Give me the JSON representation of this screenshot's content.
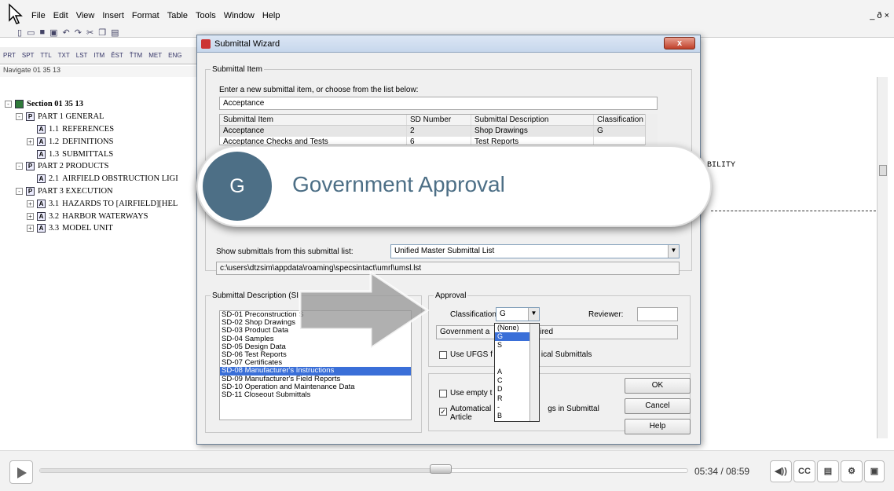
{
  "app": {
    "menu": [
      "File",
      "Edit",
      "View",
      "Insert",
      "Format",
      "Table",
      "Tools",
      "Window",
      "Help"
    ],
    "window_controls": "_ ð ×",
    "toolbar2": [
      "PRT",
      "SPT",
      "TTL",
      "TXT",
      "LST",
      "ITM",
      "ĚST",
      "ŤTM",
      "MET",
      "ENG"
    ],
    "navigate_label": "Navigate 01 35 13"
  },
  "tree": [
    {
      "level": 0,
      "box": "-",
      "icon": "",
      "num": "",
      "label": "Section 01 35 13"
    },
    {
      "level": 1,
      "box": "-",
      "icon": "P",
      "num": "",
      "label": "PART 1  GENERAL"
    },
    {
      "level": 2,
      "box": "",
      "icon": "A",
      "num": "1.1",
      "label": "REFERENCES"
    },
    {
      "level": 2,
      "box": "+",
      "icon": "A",
      "num": "1.2",
      "label": "DEFINITIONS"
    },
    {
      "level": 2,
      "box": "",
      "icon": "A",
      "num": "1.3",
      "label": "SUBMITTALS"
    },
    {
      "level": 1,
      "box": "-",
      "icon": "P",
      "num": "",
      "label": "PART 2  PRODUCTS"
    },
    {
      "level": 2,
      "box": "",
      "icon": "A",
      "num": "2.1",
      "label": "AIRFIELD OBSTRUCTION LIGI"
    },
    {
      "level": 1,
      "box": "-",
      "icon": "P",
      "num": "",
      "label": "PART 3  EXECUTION"
    },
    {
      "level": 2,
      "box": "+",
      "icon": "A",
      "num": "3.1",
      "label": "HAZARDS TO [AIRFIELD][HEL"
    },
    {
      "level": 2,
      "box": "+",
      "icon": "A",
      "num": "3.2",
      "label": "HARBOR WATERWAYS"
    },
    {
      "level": 2,
      "box": "+",
      "icon": "A",
      "num": "3.3",
      "label": "MODEL UNIT"
    }
  ],
  "doc": {
    "ability_text": "BILITY"
  },
  "wizard": {
    "title": "Submittal Wizard",
    "close": "x",
    "item_legend": "Submittal Item",
    "instruction": "Enter a new submittal item, or choose from the list below:",
    "item_value": "Acceptance",
    "columns": [
      "Submittal Item",
      "SD Number",
      "Submittal Description",
      "Classification"
    ],
    "rows": [
      [
        "Acceptance",
        "2",
        "Shop Drawings",
        "G"
      ],
      [
        "Acceptance Checks and Tests",
        "6",
        "Test Reports",
        ""
      ]
    ],
    "show_label": "Show submittals from this submittal list:",
    "list_value": "Unified Master Submittal List",
    "path": "c:\\users\\dtzsim\\appdata\\roaming\\specsintact\\umrl\\umsl.lst",
    "sd_legend": "Submittal Description (SI",
    "sd_items": [
      "SD-01 Preconstruction S",
      "SD-02 Shop Drawings",
      "SD-03 Product Data",
      "SD-04 Samples",
      "SD-05 Design Data",
      "SD-06 Test Reports",
      "SD-07 Certificates",
      "SD-08 Manufacturer's Instructions",
      "SD-09 Manufacturer's Field Reports",
      "SD-10 Operation and Maintenance Data",
      "SD-11 Closeout Submittals"
    ],
    "approval_legend": "Approval",
    "classification_label": "Classification",
    "classification_value": "G",
    "reviewer_label": "Reviewer:",
    "gov_text": "Government a",
    "gov_text2": "ired",
    "ufgs_label": "Use UFGS f",
    "ufgs_label2": "ical Submittals",
    "empty_label": "Use empty t",
    "auto_label": "Automatical",
    "auto_label2": "gs in Submittal",
    "article_label": "Article",
    "dropdown_options": [
      "(None)",
      "G",
      "S",
      "",
      "",
      "A",
      "C",
      "D",
      "R",
      "-",
      "B"
    ],
    "ok": "OK",
    "cancel": "Cancel",
    "help": "Help"
  },
  "callout": {
    "letter": "G",
    "text": "Government Approval"
  },
  "player": {
    "time": "05:34 / 08:59",
    "progress": 0.617,
    "cc": "CC"
  },
  "colors": {
    "accent": "#4d6f86",
    "selection": "#3a6fd8"
  }
}
